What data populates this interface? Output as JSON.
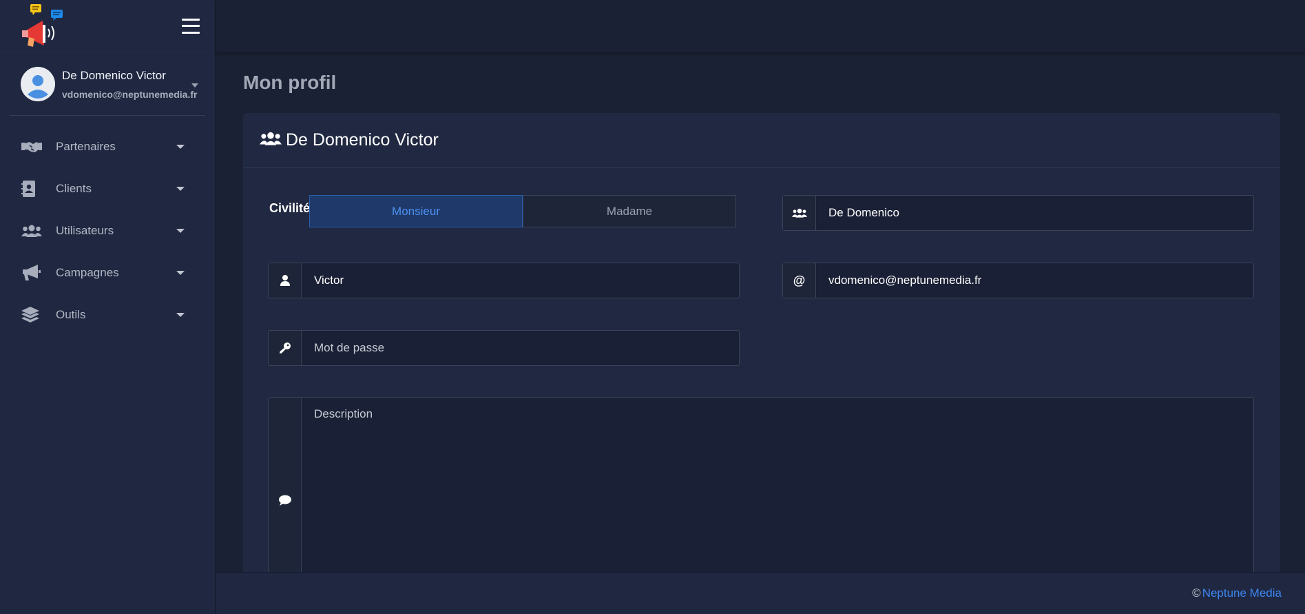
{
  "sidebar": {
    "user": {
      "name": "De Domenico Victor",
      "email": "vdomenico@neptunemedia.fr"
    },
    "items": [
      {
        "label": "Partenaires",
        "icon": "handshake-icon"
      },
      {
        "label": "Clients",
        "icon": "address-book-icon"
      },
      {
        "label": "Utilisateurs",
        "icon": "users-icon"
      },
      {
        "label": "Campagnes",
        "icon": "megaphone-icon"
      },
      {
        "label": "Outils",
        "icon": "layers-icon"
      }
    ]
  },
  "page": {
    "title": "Mon profil"
  },
  "card": {
    "title": "De Domenico Victor",
    "civilite_label": "Civilité",
    "civilite_options": [
      "Monsieur",
      "Madame"
    ],
    "civilite_selected": "Monsieur",
    "nom_value": "De Domenico",
    "prenom_value": "Victor",
    "email_value": "vdomenico@neptunemedia.fr",
    "password_placeholder": "Mot de passe",
    "description_placeholder": "Description"
  },
  "footer": {
    "copyright": "©",
    "link_label": "Neptune Media"
  },
  "colors": {
    "accent": "#3d86f0",
    "background": "#1b2134",
    "sidebar": "#1f2741",
    "card": "#212942"
  }
}
